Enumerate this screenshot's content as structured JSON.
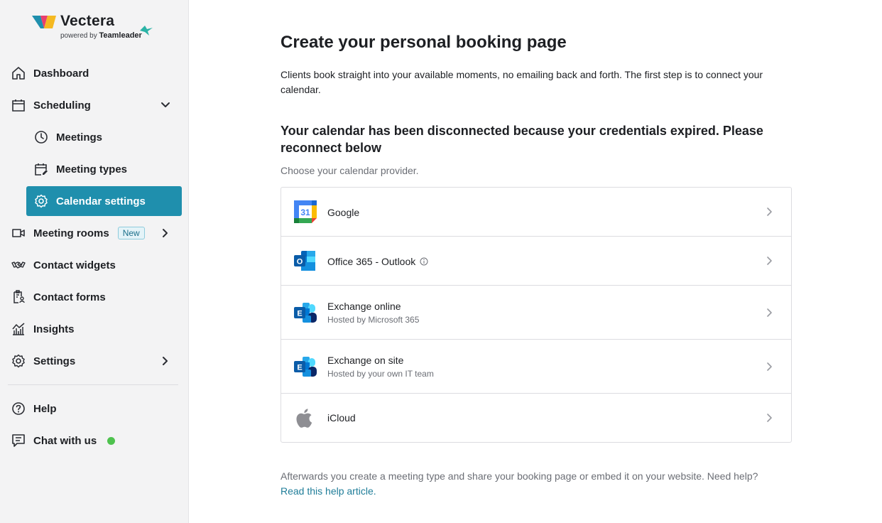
{
  "brand": {
    "name": "Vectera",
    "powered_prefix": "powered by",
    "powered_brand": "Teamleader"
  },
  "sidebar": {
    "items": [
      {
        "label": "Dashboard",
        "icon": "home-icon"
      },
      {
        "label": "Scheduling",
        "icon": "calendar-icon",
        "expanded": true
      },
      {
        "label": "Meetings",
        "icon": "clock-icon"
      },
      {
        "label": "Meeting types",
        "icon": "calendar-edit-icon"
      },
      {
        "label": "Calendar settings",
        "icon": "gear-icon",
        "active": true
      },
      {
        "label": "Meeting rooms",
        "icon": "video-camera-icon",
        "badge": "New"
      },
      {
        "label": "Contact widgets",
        "icon": "handshake-icon"
      },
      {
        "label": "Contact forms",
        "icon": "clipboard-user-icon"
      },
      {
        "label": "Insights",
        "icon": "chart-icon"
      },
      {
        "label": "Settings",
        "icon": "gear-icon"
      },
      {
        "label": "Help",
        "icon": "question-icon"
      },
      {
        "label": "Chat with us",
        "icon": "chat-icon",
        "status": "online"
      }
    ]
  },
  "main": {
    "title": "Create your personal booking page",
    "intro": "Clients book straight into your available moments, no emailing back and forth. The first step is to connect your calendar.",
    "warning": "Your calendar has been disconnected because your credentials expired. Please reconnect below",
    "choose_label": "Choose your calendar provider.",
    "providers": [
      {
        "name": "Google",
        "subtitle": "",
        "icon": "google-calendar-icon"
      },
      {
        "name": "Office 365 - Outlook",
        "subtitle": "",
        "icon": "outlook-icon",
        "info": true
      },
      {
        "name": "Exchange online",
        "subtitle": "Hosted by Microsoft 365",
        "icon": "exchange-icon"
      },
      {
        "name": "Exchange on site",
        "subtitle": "Hosted by your own IT team",
        "icon": "exchange-icon"
      },
      {
        "name": "iCloud",
        "subtitle": "",
        "icon": "apple-icon"
      }
    ],
    "footer_text": "Afterwards you create a meeting type and share your booking page or embed it on your website. Need help?",
    "footer_link": "Read this help article."
  },
  "colors": {
    "accent": "#1f8fad",
    "sidebar_bg": "#f3f3f4",
    "online": "#4ec24e",
    "link": "#1f7d99"
  }
}
